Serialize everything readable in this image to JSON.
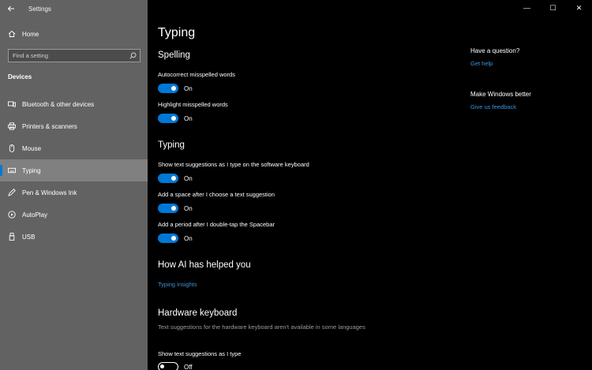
{
  "app": {
    "title": "Settings",
    "home_label": "Home",
    "search_placeholder": "Find a setting",
    "section": "Devices"
  },
  "sidebar": {
    "items": [
      {
        "label": "Bluetooth & other devices",
        "icon": "bluetooth-devices-icon"
      },
      {
        "label": "Printers & scanners",
        "icon": "printer-icon"
      },
      {
        "label": "Mouse",
        "icon": "mouse-icon"
      },
      {
        "label": "Typing",
        "icon": "keyboard-icon",
        "active": true
      },
      {
        "label": "Pen & Windows Ink",
        "icon": "pen-icon"
      },
      {
        "label": "AutoPlay",
        "icon": "autoplay-icon"
      },
      {
        "label": "USB",
        "icon": "usb-icon"
      }
    ]
  },
  "window_controls": {
    "minimize": "—",
    "maximize": "☐",
    "close": "✕"
  },
  "page": {
    "title": "Typing",
    "spelling": {
      "heading": "Spelling",
      "autocorrect_label": "Autocorrect misspelled words",
      "autocorrect_state": "On",
      "highlight_label": "Highlight misspelled words",
      "highlight_state": "On"
    },
    "typing": {
      "heading": "Typing",
      "suggestions_label": "Show text suggestions as I type on the software keyboard",
      "suggestions_state": "On",
      "space_label": "Add a space after I choose a text suggestion",
      "space_state": "On",
      "period_label": "Add a period after I double-tap the Spacebar",
      "period_state": "On"
    },
    "ai": {
      "heading": "How AI has helped you",
      "link": "Typing insights"
    },
    "hardware": {
      "heading": "Hardware keyboard",
      "description": "Text suggestions for the hardware keyboard aren't available in some languages",
      "suggestions_label": "Show text suggestions as I type",
      "suggestions_state": "Off"
    }
  },
  "help": {
    "question_heading": "Have a question?",
    "get_help": "Get help",
    "better_heading": "Make Windows better",
    "feedback": "Give us feedback"
  },
  "colors": {
    "accent": "#0078d7",
    "link": "#3a96dd",
    "sidebar_bg": "#626262",
    "main_bg": "#000000"
  }
}
